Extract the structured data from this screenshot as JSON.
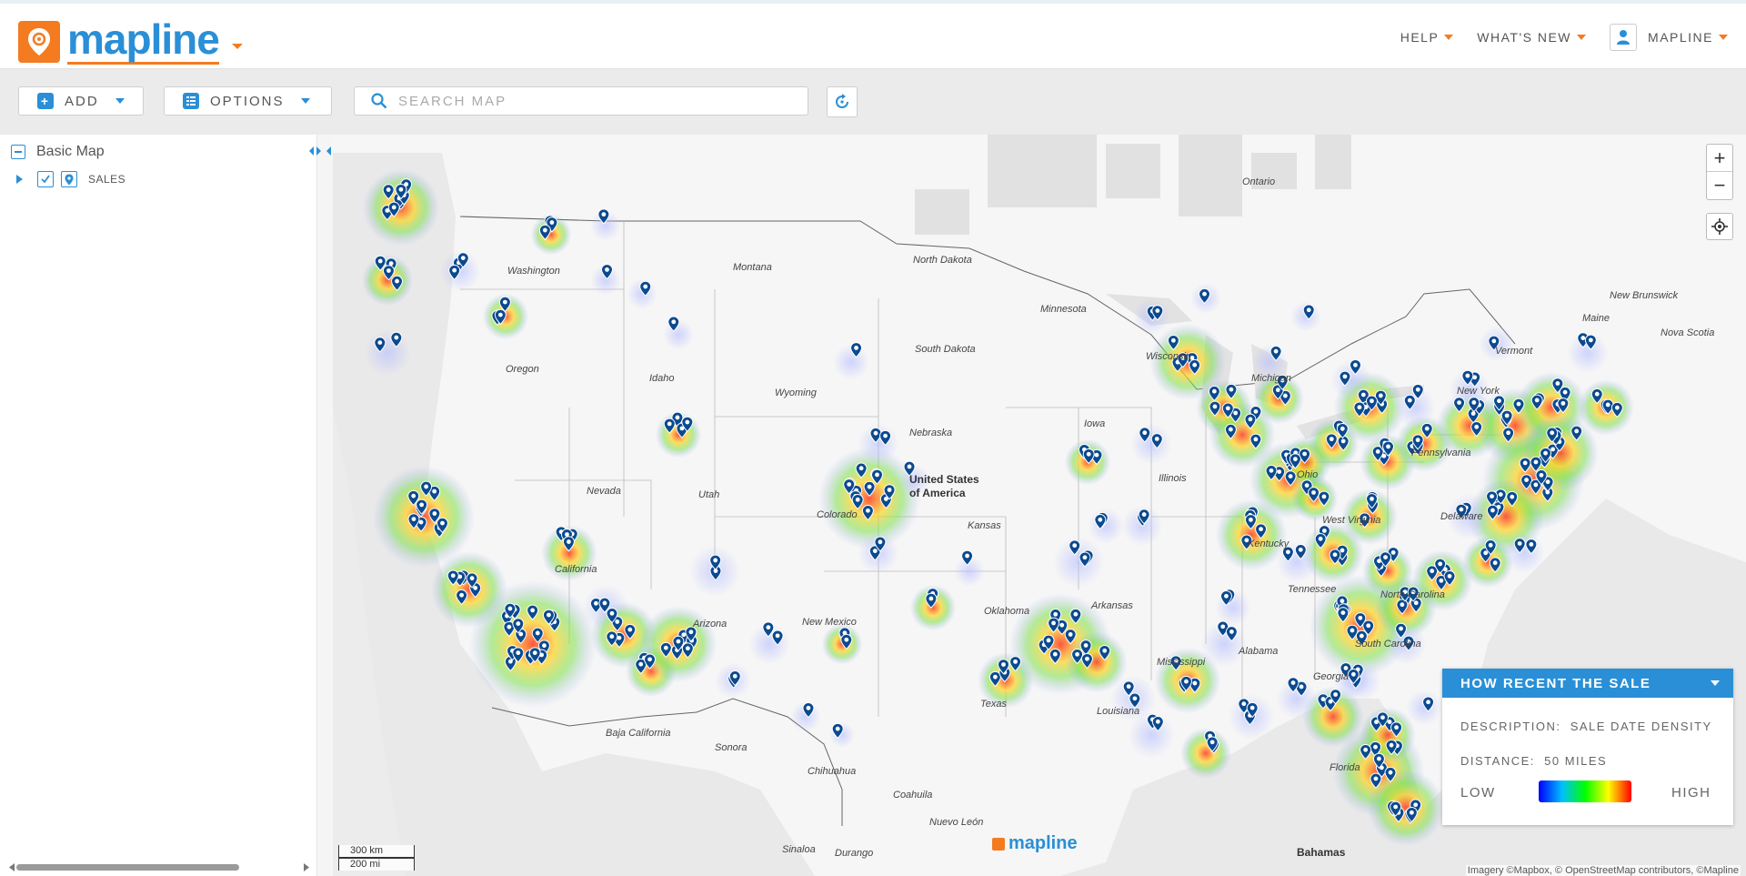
{
  "app": {
    "logo_text": "mapline",
    "accent_color": "#f47b20",
    "brand_color": "#2a8fd6"
  },
  "topnav": {
    "help": "HELP",
    "whats_new": "WHAT'S NEW",
    "user": "MAPLINE"
  },
  "toolbar": {
    "add_label": "ADD",
    "options_label": "OPTIONS",
    "search_placeholder": "SEARCH MAP",
    "refresh_icon": "refresh-icon"
  },
  "sidebar": {
    "root_label": "Basic Map",
    "layers": [
      {
        "label": "SALES",
        "checked": true
      }
    ]
  },
  "map": {
    "labels": {
      "ontario": "Ontario",
      "new_brunswick": "New Brunswick",
      "nova_scotia": "Nova Scotia",
      "maine": "Maine",
      "vermont": "Vermont",
      "new_york": "New York",
      "pennsylvania": "Pennsylvania",
      "delaware": "Delaware",
      "west_virginia": "West Virginia",
      "north_carolina": "North Carolina",
      "south_carolina": "South Carolina",
      "georgia": "Georgia",
      "florida": "Florida",
      "bahamas": "Bahamas",
      "kentucky": "Kentucky",
      "tennessee": "Tennessee",
      "alabama": "Alabama",
      "mississippi": "Mississippi",
      "louisiana": "Louisiana",
      "arkansas": "Arkansas",
      "illinois": "Illinois",
      "wisconsin": "Wisconsin",
      "michigan": "Michigan",
      "ohio": "Ohio",
      "iowa": "Iowa",
      "minnesota": "Minnesota",
      "north_dakota": "North Dakota",
      "south_dakota": "South Dakota",
      "nebraska": "Nebraska",
      "kansas": "Kansas",
      "oklahoma": "Oklahoma",
      "texas": "Texas",
      "new_mexico": "New Mexico",
      "colorado": "Colorado",
      "wyoming": "Wyoming",
      "montana": "Montana",
      "idaho": "Idaho",
      "washington": "Washington",
      "oregon": "Oregon",
      "nevada": "Nevada",
      "utah": "Utah",
      "arizona": "Arizona",
      "california": "California",
      "united_states": "United States of America",
      "baja_california": "Baja California",
      "sonora": "Sonora",
      "chihuahua": "Chihuahua",
      "coahuila": "Coahuila",
      "nuevo_leon": "Nuevo León",
      "sinaloa": "Sinaloa",
      "durango": "Durango"
    },
    "scale_km": "300 km",
    "scale_mi": "200 mi",
    "attribution": "Imagery ©Mapbox, © OpenStreetMap contributors, ©Mapline",
    "watermark": "mapline",
    "pin_color": "#0b4a8f"
  },
  "legend": {
    "title": "HOW RECENT THE SALE",
    "description_label": "DESCRIPTION:",
    "description_value": "SALE DATE DENSITY",
    "distance_label": "DISTANCE:",
    "distance_value": "50 MILES",
    "low": "LOW",
    "high": "HIGH"
  }
}
